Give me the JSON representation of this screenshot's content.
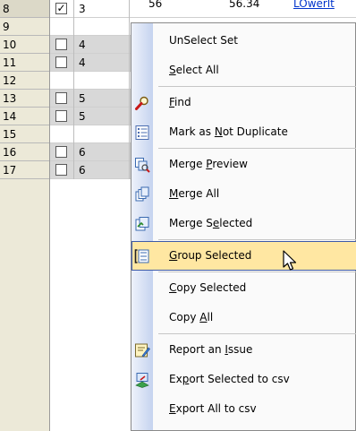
{
  "grid": {
    "rows": [
      {
        "num": "8",
        "checked": true,
        "val": "3",
        "extra": "56",
        "extra2": "56.34",
        "link": "LOwerlt",
        "style": "first"
      },
      {
        "num": "9",
        "checked": null,
        "val": "",
        "style": "alt"
      },
      {
        "num": "10",
        "checked": false,
        "val": "4",
        "style": "dup"
      },
      {
        "num": "11",
        "checked": false,
        "val": "4",
        "style": "dup"
      },
      {
        "num": "12",
        "checked": null,
        "val": "",
        "style": "alt"
      },
      {
        "num": "13",
        "checked": false,
        "val": "5",
        "style": "dup"
      },
      {
        "num": "14",
        "checked": false,
        "val": "5",
        "style": "dup"
      },
      {
        "num": "15",
        "checked": null,
        "val": "",
        "style": "alt"
      },
      {
        "num": "16",
        "checked": false,
        "val": "6",
        "style": "dup"
      },
      {
        "num": "17",
        "checked": false,
        "val": "6",
        "style": "dup"
      }
    ]
  },
  "menu": {
    "items": [
      {
        "id": "unselect-set",
        "pre": "UnSelect Set",
        "u": "",
        "post": "",
        "icon": ""
      },
      {
        "id": "select-all",
        "pre": "",
        "u": "S",
        "post": "elect All",
        "icon": ""
      },
      {
        "id": "find",
        "pre": "",
        "u": "F",
        "post": "ind",
        "icon": "find-magnifier-icon"
      },
      {
        "id": "mark-not-duplicate",
        "pre": "Mark as ",
        "u": "N",
        "post": "ot Duplicate",
        "icon": "list-icon"
      },
      {
        "id": "merge-preview",
        "pre": "Merge ",
        "u": "P",
        "post": "review",
        "icon": "merge-preview-icon"
      },
      {
        "id": "merge-all",
        "pre": "",
        "u": "M",
        "post": "erge All",
        "icon": "merge-all-icon"
      },
      {
        "id": "merge-selected",
        "pre": "Merge S",
        "u": "e",
        "post": "lected",
        "icon": "merge-selected-icon"
      },
      {
        "id": "group-selected",
        "pre": "",
        "u": "G",
        "post": "roup Selected",
        "icon": "group-icon",
        "highlight": true
      },
      {
        "id": "copy-selected",
        "pre": "",
        "u": "C",
        "post": "opy Selected",
        "icon": ""
      },
      {
        "id": "copy-all",
        "pre": "Copy ",
        "u": "A",
        "post": "ll",
        "icon": ""
      },
      {
        "id": "report-issue",
        "pre": "Report an ",
        "u": "I",
        "post": "ssue",
        "icon": "report-icon"
      },
      {
        "id": "export-selected",
        "pre": "Ex",
        "u": "p",
        "post": "ort Selected to csv",
        "icon": "export-icon"
      },
      {
        "id": "export-all",
        "pre": "",
        "u": "E",
        "post": "xport All to csv",
        "icon": ""
      }
    ],
    "separator_after": [
      "select-all",
      "mark-not-duplicate",
      "merge-selected",
      "group-selected",
      "copy-all"
    ]
  },
  "colors": {
    "highlight": "#ffe7a2",
    "highlight_border": "#3d5aa8",
    "strip": "#c5d3ef",
    "link": "#0033cc"
  }
}
